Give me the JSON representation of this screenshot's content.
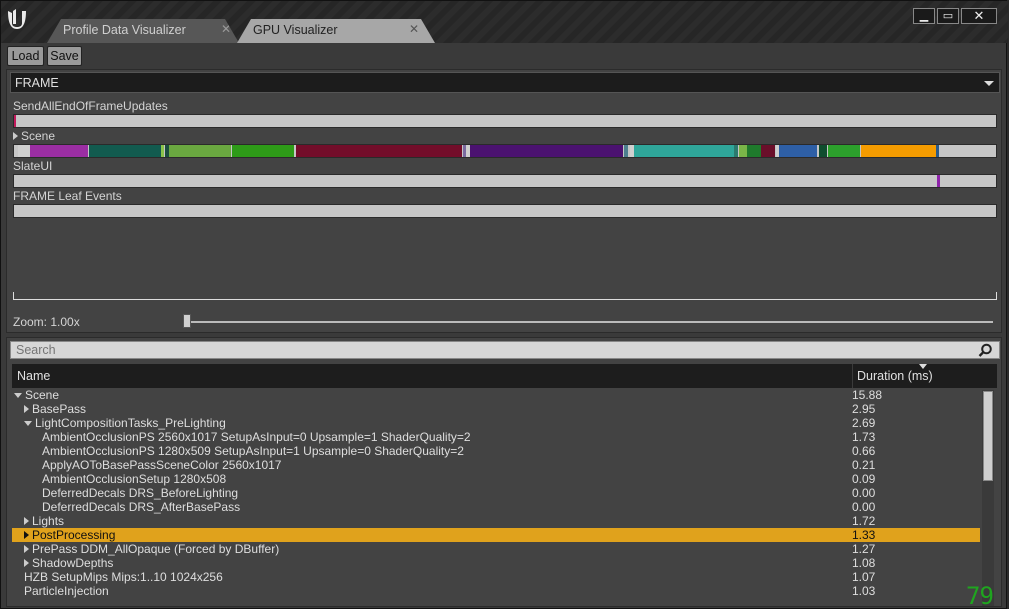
{
  "tabs": [
    {
      "label": "Profile Data Visualizer",
      "close": "✕"
    },
    {
      "label": "GPU Visualizer",
      "close": "✕"
    }
  ],
  "window_controls": {
    "minimize": "▁",
    "maximize": "▭",
    "close": "✕"
  },
  "toolbar": {
    "load_label": "Load",
    "save_label": "Save"
  },
  "frame_dropdown": {
    "value": "FRAME"
  },
  "timeline_rows": [
    {
      "label": "SendAllEndOfFrameUpdates",
      "expandable": false
    },
    {
      "label": "Scene",
      "expandable": true
    },
    {
      "label": "SlateUI",
      "expandable": false
    },
    {
      "label": "FRAME Leaf Events",
      "expandable": false
    }
  ],
  "zoom": {
    "label": "Zoom: 1.00x",
    "value": 1.0
  },
  "search": {
    "placeholder": "Search"
  },
  "table": {
    "columns": {
      "name": "Name",
      "duration": "Duration (ms)"
    },
    "rows": [
      {
        "name": "Scene",
        "duration": "15.88",
        "depth": 0,
        "expander": "open"
      },
      {
        "name": "BasePass",
        "duration": "2.95",
        "depth": 1,
        "expander": "closed"
      },
      {
        "name": "LightCompositionTasks_PreLighting",
        "duration": "2.69",
        "depth": 1,
        "expander": "open"
      },
      {
        "name": "AmbientOcclusionPS 2560x1017 SetupAsInput=0 Upsample=1 ShaderQuality=2",
        "duration": "1.73",
        "depth": 2,
        "expander": "none"
      },
      {
        "name": "AmbientOcclusionPS 1280x509 SetupAsInput=1 Upsample=0 ShaderQuality=2",
        "duration": "0.66",
        "depth": 2,
        "expander": "none"
      },
      {
        "name": "ApplyAOToBasePassSceneColor 2560x1017",
        "duration": "0.21",
        "depth": 2,
        "expander": "none"
      },
      {
        "name": "AmbientOcclusionSetup 1280x508",
        "duration": "0.09",
        "depth": 2,
        "expander": "none"
      },
      {
        "name": "DeferredDecals DRS_BeforeLighting",
        "duration": "0.00",
        "depth": 2,
        "expander": "none"
      },
      {
        "name": "DeferredDecals DRS_AfterBasePass",
        "duration": "0.00",
        "depth": 2,
        "expander": "none"
      },
      {
        "name": "Lights",
        "duration": "1.72",
        "depth": 1,
        "expander": "closed"
      },
      {
        "name": "PostProcessing",
        "duration": "1.33",
        "depth": 1,
        "expander": "closed",
        "selected": true
      },
      {
        "name": "PrePass DDM_AllOpaque (Forced by DBuffer)",
        "duration": "1.27",
        "depth": 1,
        "expander": "closed"
      },
      {
        "name": "ShadowDepths",
        "duration": "1.08",
        "depth": 1,
        "expander": "closed"
      },
      {
        "name": "HZB SetupMips Mips:1..10 1024x256",
        "duration": "1.07",
        "depth": 1,
        "expander": "none"
      },
      {
        "name": "ParticleInjection",
        "duration": "1.03",
        "depth": 1,
        "expander": "none"
      }
    ]
  },
  "fps_counter": "79",
  "colors": {
    "selection": "#e0a21c",
    "fps": "#1fa51f"
  }
}
